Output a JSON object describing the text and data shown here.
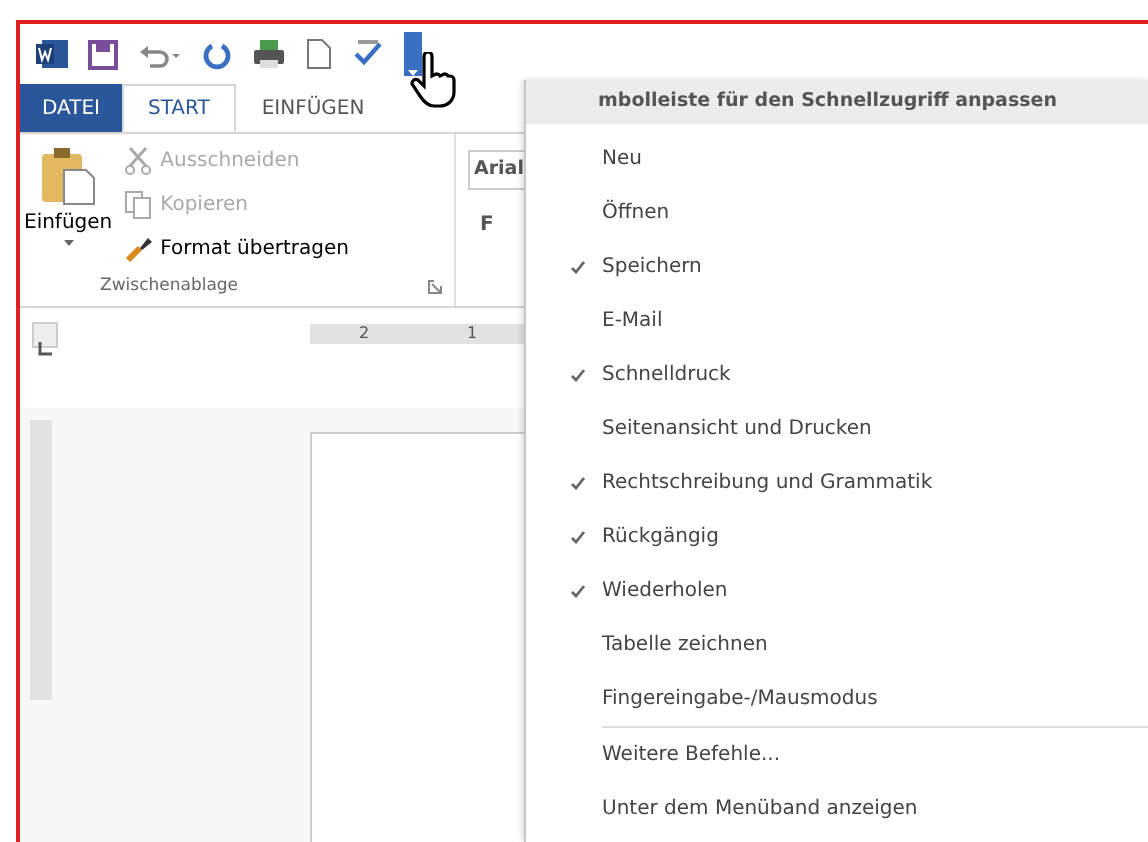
{
  "qat_dropdown": {
    "expanded": true
  },
  "tabs": [
    {
      "label": "DATEI",
      "kind": "file",
      "selected": false
    },
    {
      "label": "START",
      "kind": "tab",
      "selected": true
    },
    {
      "label": "EINFÜGEN",
      "kind": "tab",
      "selected": false
    }
  ],
  "clipboard": {
    "paste": "Einfügen",
    "group_label": "Zwischenablage",
    "commands": [
      {
        "label": "Ausschneiden",
        "kind": "cut",
        "disabled": true
      },
      {
        "label": "Kopieren",
        "kind": "copy",
        "disabled": true
      },
      {
        "label": "Format übertragen",
        "kind": "brush",
        "disabled": false
      }
    ]
  },
  "font": {
    "font_name": "Arial",
    "bold": "F"
  },
  "ruler": {
    "labels": [
      "2",
      "1"
    ]
  },
  "menu": {
    "title": "mbolleiste für den Schnellzugriff anpassen",
    "items": [
      {
        "label": "Neu",
        "checked": false
      },
      {
        "label": "Öffnen",
        "checked": false
      },
      {
        "label": "Speichern",
        "checked": true
      },
      {
        "label": "E-Mail",
        "checked": false
      },
      {
        "label": "Schnelldruck",
        "checked": true
      },
      {
        "label": "Seitenansicht und Drucken",
        "checked": false
      },
      {
        "label": "Rechtschreibung und Grammatik",
        "checked": true
      },
      {
        "label": "Rückgängig",
        "checked": true
      },
      {
        "label": "Wiederholen",
        "checked": true
      },
      {
        "label": "Tabelle zeichnen",
        "checked": false
      },
      {
        "label": "Fingereingabe-/Mausmodus",
        "checked": false
      }
    ],
    "footer": [
      "Weitere Befehle...",
      "Unter dem Menüband anzeigen"
    ]
  }
}
